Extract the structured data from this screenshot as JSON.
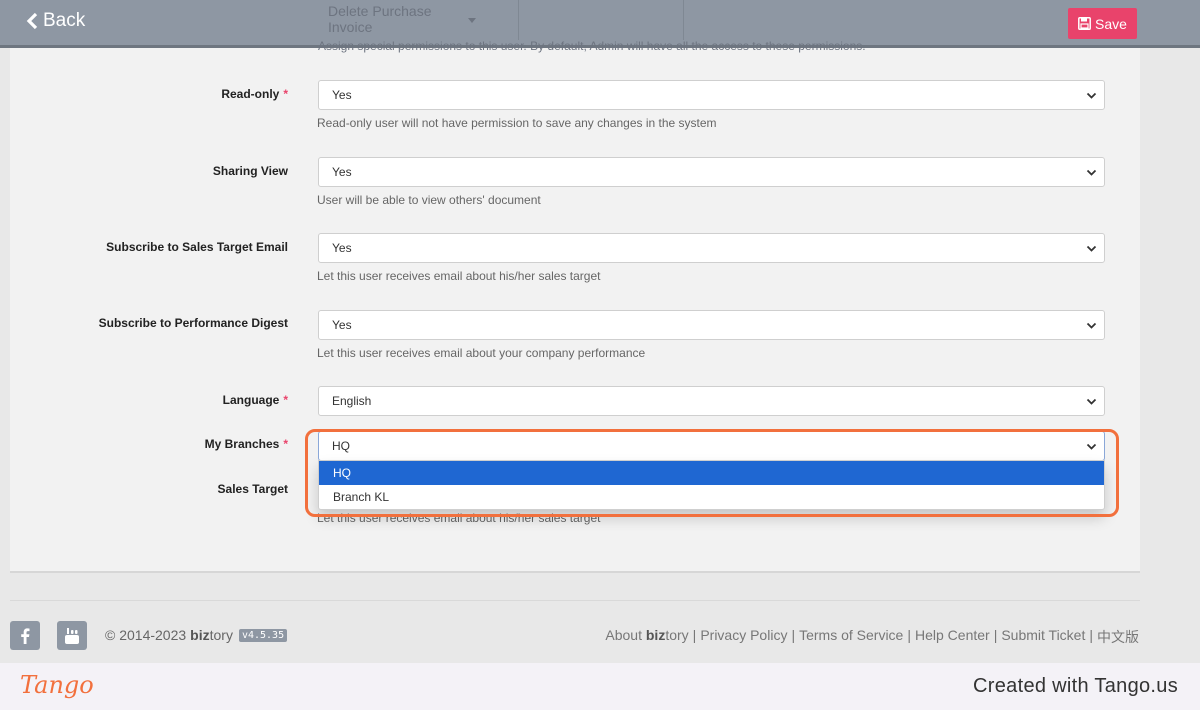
{
  "topbar": {
    "back_label": "Back",
    "save_label": "Save",
    "ghost_select_value": "Delete Purchase Invoice",
    "ghost_help": "Assign special permissions to this user. By default, Admin will have all the access to these permissions."
  },
  "form": {
    "fields": [
      {
        "label": "Read-only",
        "required": true,
        "value": "Yes",
        "help": "Read-only user will not have permission to save any changes in the system"
      },
      {
        "label": "Sharing View",
        "required": false,
        "value": "Yes",
        "help": "User will be able to view others' document"
      },
      {
        "label": "Subscribe to Sales Target Email",
        "required": false,
        "value": "Yes",
        "help": "Let this user receives email about his/her sales target"
      },
      {
        "label": "Subscribe to Performance Digest",
        "required": false,
        "value": "Yes",
        "help": "Let this user receives email about your company performance"
      },
      {
        "label": "Language",
        "required": true,
        "value": "English",
        "help": ""
      },
      {
        "label": "My Branches",
        "required": true,
        "value": "HQ",
        "help": ""
      },
      {
        "label": "Sales Target",
        "required": false,
        "value": "",
        "help": "Let this user receives email about his/her sales target"
      }
    ],
    "required_marker": "*",
    "branch_options": [
      "HQ",
      "Branch KL"
    ],
    "branch_selected_index": 0
  },
  "footer": {
    "copyright": "© 2014-2023",
    "brand_bold": "biz",
    "brand_rest": "tory",
    "version": "v4.5.35",
    "about_prefix": "About",
    "links": [
      "Privacy Policy",
      "Terms of Service",
      "Help Center",
      "Submit Ticket",
      "中文版"
    ],
    "separator": "|"
  },
  "watermark": {
    "logo": "Tango",
    "credit": "Created with Tango.us"
  },
  "colors": {
    "topbar": "#8e97a3",
    "save": "#e9436b",
    "selected_option": "#1f67d2",
    "highlight": "#f2703d"
  }
}
